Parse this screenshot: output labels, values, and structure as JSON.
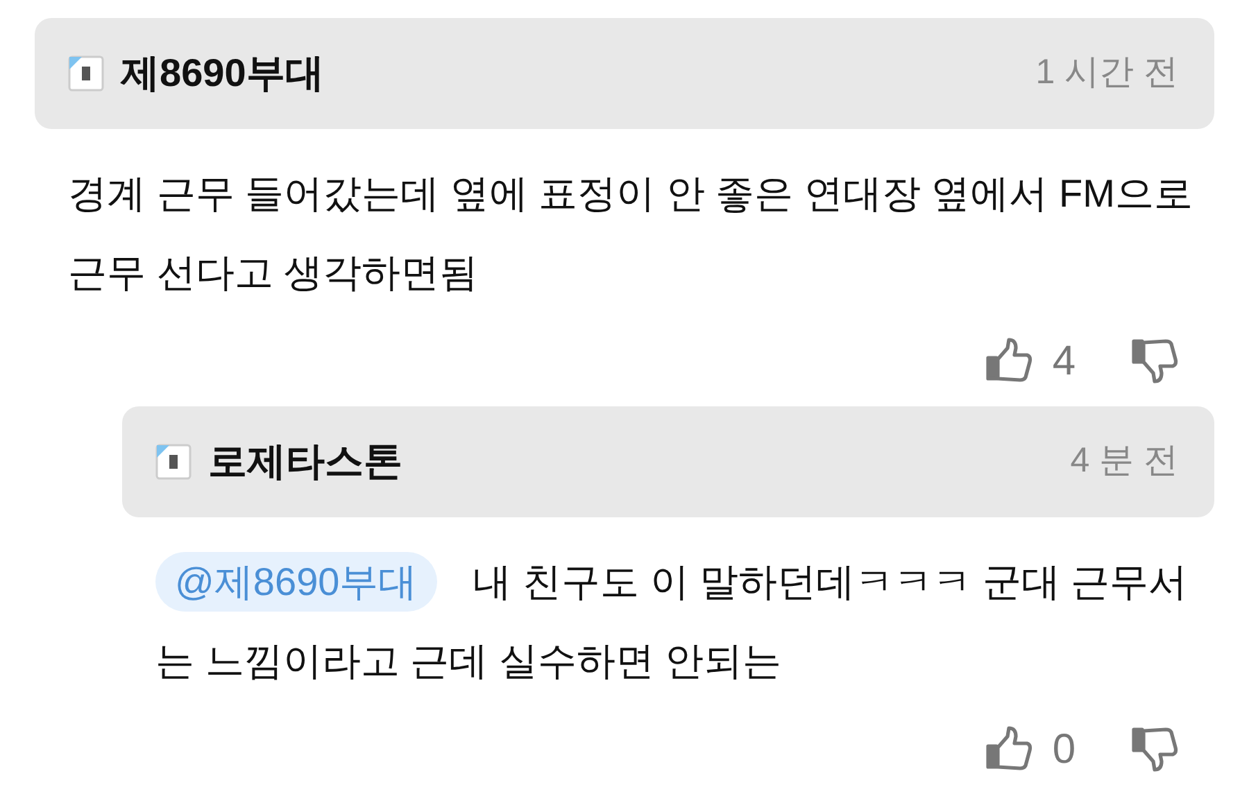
{
  "comments": [
    {
      "author": "제8690부대",
      "time": "1 시간 전",
      "text": "경계 근무 들어갔는데 옆에 표정이 안 좋은 연대장 옆에서  FM으로 근무 선다고 생각하면됨",
      "likes": "4",
      "reply": false
    },
    {
      "author": "로제타스톤",
      "time": "4 분 전",
      "mention": "@제8690부대",
      "text": "내 친구도 이 말하던데ㅋㅋㅋ 군대 근무서는 느낌이라고 근데 실수하면 안되는",
      "likes": "0",
      "reply": true
    }
  ]
}
